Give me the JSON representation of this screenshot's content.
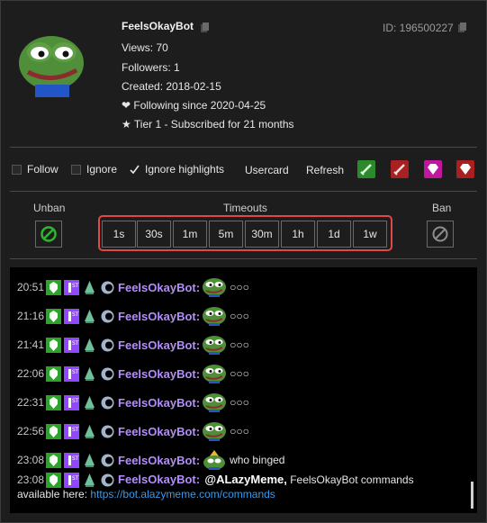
{
  "user": {
    "name": "FeelsOkayBot",
    "id_text": "ID: 196500227",
    "views": "Views: 70",
    "followers": "Followers: 1",
    "created": "Created: 2018-02-15",
    "following": "Following since 2020-04-25",
    "subscription": "Tier 1 - Subscribed for 21 months"
  },
  "options": {
    "follow": "Follow",
    "ignore": "Ignore",
    "ignore_highlights": "Ignore highlights",
    "usercard": "Usercard",
    "refresh": "Refresh",
    "follow_checked": false,
    "ignore_checked": false,
    "ignore_highlights_checked": true
  },
  "moderation": {
    "unban_label": "Unban",
    "timeouts_label": "Timeouts",
    "ban_label": "Ban",
    "timeouts": [
      "1s",
      "30s",
      "1m",
      "5m",
      "30m",
      "1h",
      "1d",
      "1w"
    ]
  },
  "chat": {
    "messages": [
      {
        "time": "20:51",
        "user": "FeelsOkayBot",
        "text": "○○○"
      },
      {
        "time": "21:16",
        "user": "FeelsOkayBot",
        "text": "○○○"
      },
      {
        "time": "21:41",
        "user": "FeelsOkayBot",
        "text": "○○○"
      },
      {
        "time": "22:06",
        "user": "FeelsOkayBot",
        "text": "○○○"
      },
      {
        "time": "22:31",
        "user": "FeelsOkayBot",
        "text": "○○○"
      },
      {
        "time": "22:56",
        "user": "FeelsOkayBot",
        "text": "○○○"
      },
      {
        "time": "23:08",
        "user": "FeelsOkayBot",
        "text": "who binged"
      },
      {
        "time": "23:08",
        "user": "FeelsOkayBot",
        "mention": "@ALazyMeme,",
        "text": "FeelsOkayBot commands",
        "text2": "available here: ",
        "link": "https://bot.alazymeme.com/commands"
      }
    ]
  },
  "colors": {
    "username": "#b38cff",
    "link": "#3b9ae8",
    "highlight_frame": "#e04848"
  }
}
